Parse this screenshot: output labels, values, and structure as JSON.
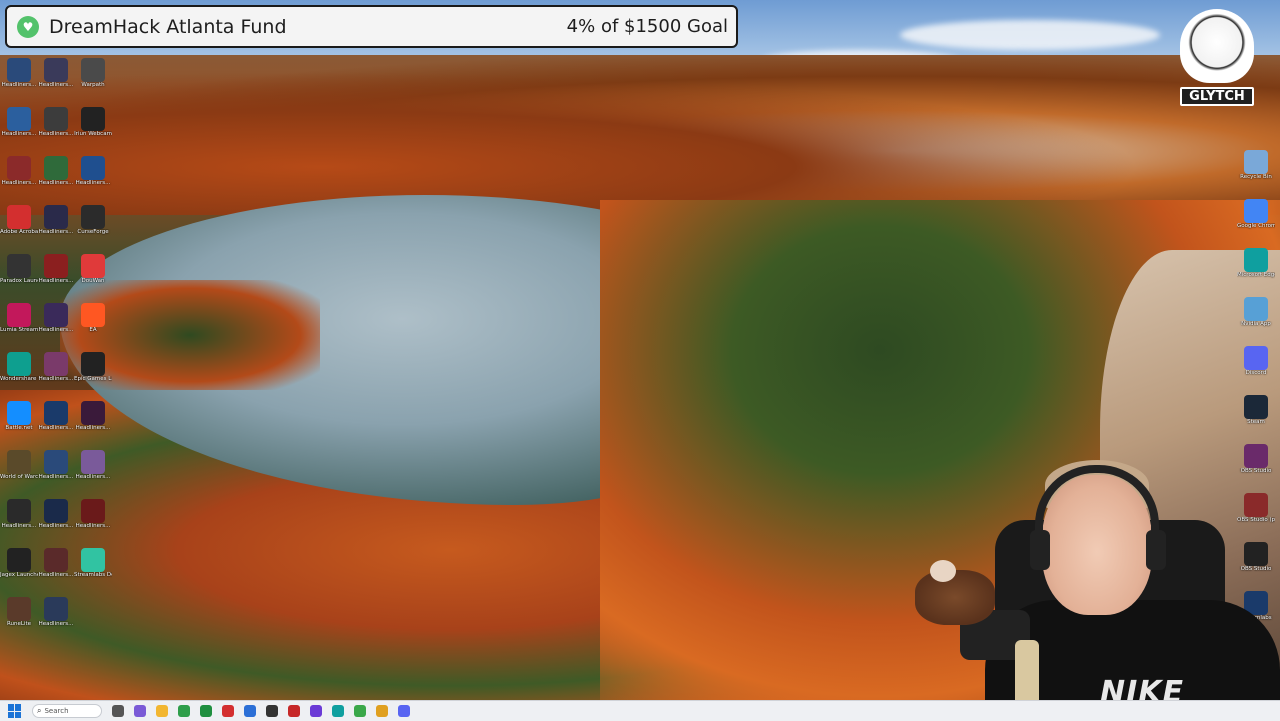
{
  "goal": {
    "title": "DreamHack Atlanta Fund",
    "progress": "4% of $1500 Goal",
    "fraction": 0.04,
    "icon": "heart-icon",
    "icon_color": "#53c26b"
  },
  "logo": {
    "text": "GLYTCH"
  },
  "desktop": {
    "left_icons": [
      {
        "label": "Headliners...",
        "color": "#2a4a7a"
      },
      {
        "label": "Headliners...",
        "color": "#3a3a5a"
      },
      {
        "label": "Warpath",
        "color": "#4a4a4a"
      },
      {
        "label": "Headliners...",
        "color": "#2b5f9e"
      },
      {
        "label": "Headliners...",
        "color": "#3c3c3c"
      },
      {
        "label": "Iriun Webcam",
        "color": "#222222"
      },
      {
        "label": "Headliners...",
        "color": "#8b2a2a"
      },
      {
        "label": "Headliners...",
        "color": "#2f6a3a"
      },
      {
        "label": "Headliners...",
        "color": "#1f4f8f"
      },
      {
        "label": "Adobe Acrobat",
        "color": "#d32f2f"
      },
      {
        "label": "Headliners...",
        "color": "#2a2a4a"
      },
      {
        "label": "CurseForge",
        "color": "#2b2b2b"
      },
      {
        "label": "Paradox Launcher v2",
        "color": "#333333"
      },
      {
        "label": "Headliners...",
        "color": "#8b1f1f"
      },
      {
        "label": "DouWan",
        "color": "#e03a3a"
      },
      {
        "label": "Lumia Stream",
        "color": "#c2185b"
      },
      {
        "label": "Headliners...",
        "color": "#3a2a5a"
      },
      {
        "label": "EA",
        "color": "#ff5722"
      },
      {
        "label": "Wondershare Filmora 14",
        "color": "#0e9f8f"
      },
      {
        "label": "Headliners...",
        "color": "#7a3a6a"
      },
      {
        "label": "Epic Games Launcher",
        "color": "#222222"
      },
      {
        "label": "Battle.net",
        "color": "#148eff"
      },
      {
        "label": "Headliners...",
        "color": "#1a3a6a"
      },
      {
        "label": "Headliners...",
        "color": "#3a1a3a"
      },
      {
        "label": "World of Warcraft",
        "color": "#5a4a2a"
      },
      {
        "label": "Headliners...",
        "color": "#2a4a7a"
      },
      {
        "label": "Headliners...",
        "color": "#7a5a9a"
      },
      {
        "label": "Headliners...",
        "color": "#2a2a2a"
      },
      {
        "label": "Headliners...",
        "color": "#1a2a4a"
      },
      {
        "label": "Headliners...",
        "color": "#6a1a1a"
      },
      {
        "label": "Jagex Launcher",
        "color": "#222222"
      },
      {
        "label": "Headliners...",
        "color": "#5a2a2a"
      },
      {
        "label": "Streamlabs Desktop",
        "color": "#31c3a2"
      },
      {
        "label": "RuneLite",
        "color": "#5a3a2a"
      },
      {
        "label": "Headliners...",
        "color": "#2a3a5a"
      }
    ],
    "right_icons": [
      {
        "label": "Recycle Bin",
        "color": "#7aa8d8"
      },
      {
        "label": "Google Chrome",
        "color": "#4285f4"
      },
      {
        "label": "Microsoft Edge",
        "color": "#0f9f9f"
      },
      {
        "label": "Nvidia App",
        "color": "#57a0d6"
      },
      {
        "label": "Discord",
        "color": "#5865f2"
      },
      {
        "label": "Steam",
        "color": "#1b2838"
      },
      {
        "label": "OBS Studio",
        "color": "#6a2a6a"
      },
      {
        "label": "OBS Studio (portable)",
        "color": "#8a2a2a"
      },
      {
        "label": "OBS Studio",
        "color": "#222222"
      },
      {
        "label": "Streamlabs",
        "color": "#1a3a6a"
      }
    ]
  },
  "taskbar": {
    "search_placeholder": "Search",
    "apps": [
      {
        "name": "pen-icon",
        "color": "#555555"
      },
      {
        "name": "copilot-icon",
        "color": "#7a5ad6"
      },
      {
        "name": "file-explorer-icon",
        "color": "#f2b630"
      },
      {
        "name": "app-icon-green",
        "color": "#2e9e4a"
      },
      {
        "name": "app-icon-green-2",
        "color": "#1f8f3f"
      },
      {
        "name": "app-icon-red",
        "color": "#d32f2f"
      },
      {
        "name": "app-icon-blue",
        "color": "#2b6fd6"
      },
      {
        "name": "app-icon-dark",
        "color": "#333333"
      },
      {
        "name": "app-icon-red-2",
        "color": "#c62828"
      },
      {
        "name": "app-icon-purple",
        "color": "#6a3ad6"
      },
      {
        "name": "app-icon-edge",
        "color": "#0f9f9f"
      },
      {
        "name": "app-icon-green-3",
        "color": "#3aa84a"
      },
      {
        "name": "chrome-icon",
        "color": "#e0a020"
      },
      {
        "name": "discord-icon",
        "color": "#5865f2"
      }
    ]
  }
}
